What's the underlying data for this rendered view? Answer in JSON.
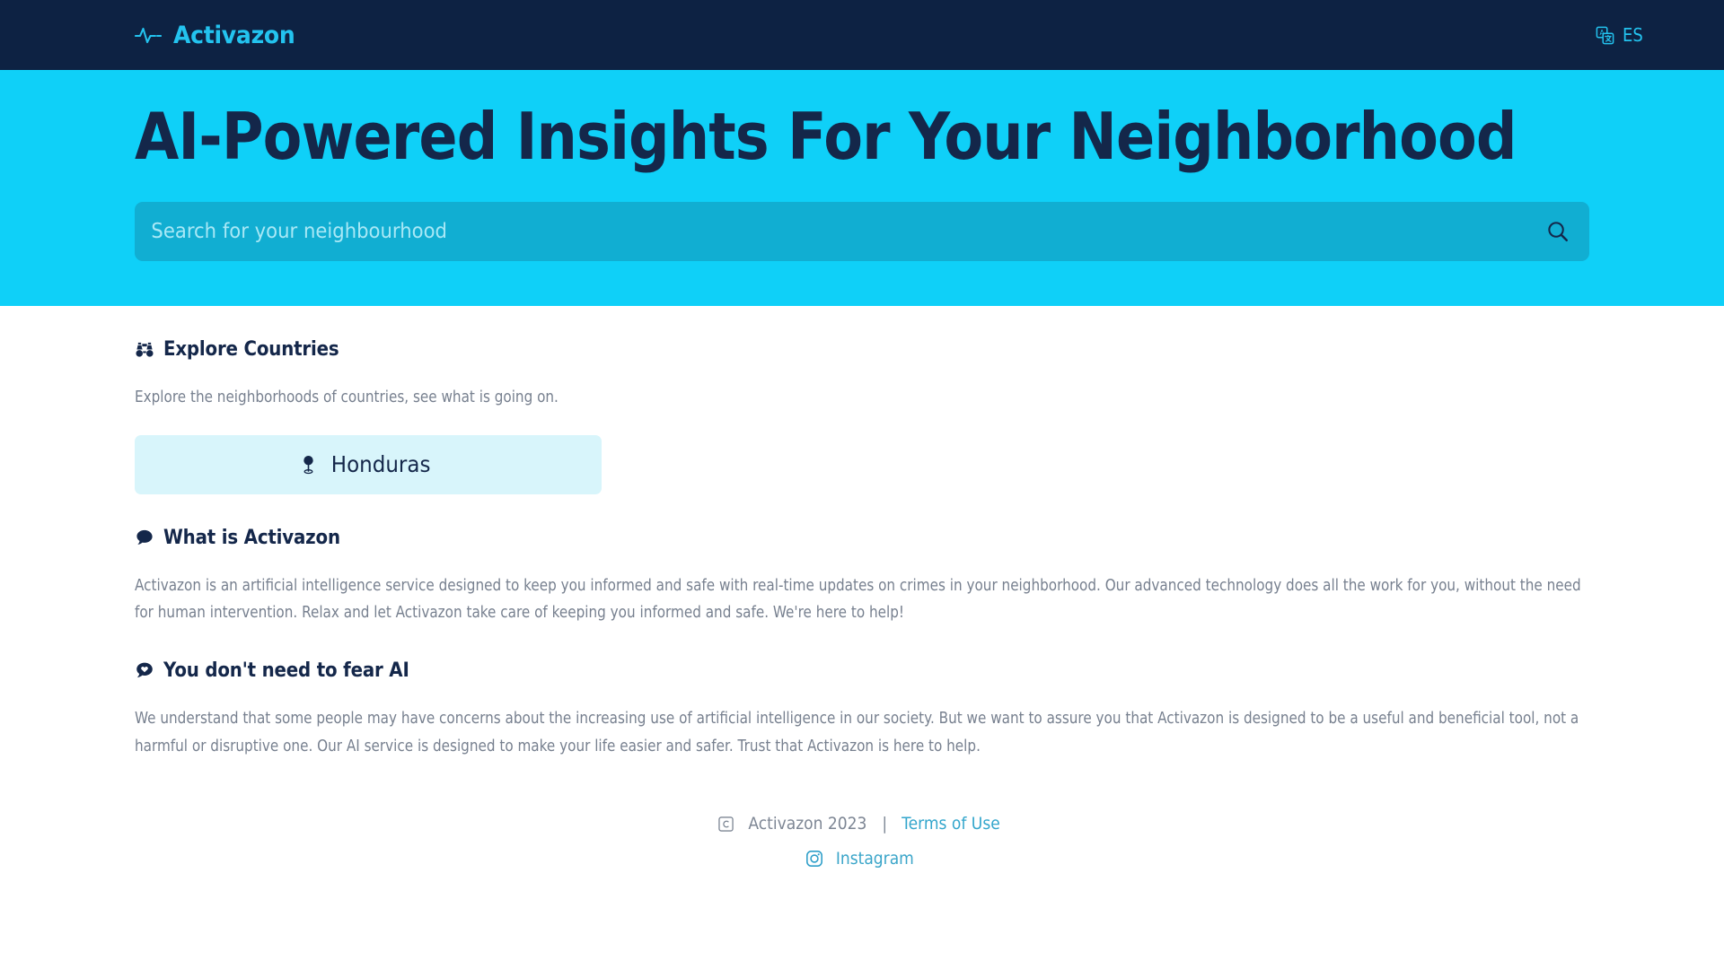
{
  "header": {
    "brand_name": "Activazon",
    "brand_icon": "pulse-wave-icon",
    "language": {
      "icon": "translate-icon",
      "label": "ES"
    }
  },
  "hero": {
    "title": "AI-Powered Insights For Your Neighborhood",
    "search": {
      "placeholder": "Search for your neighbourhood",
      "value": "",
      "button_icon": "search-icon"
    },
    "background_color": "#0fd0f8",
    "title_color": "#14274a"
  },
  "sections": {
    "explore": {
      "icon": "binoculars-icon",
      "title": "Explore Countries",
      "description": "Explore the neighborhoods of countries, see what is going on.",
      "countries": [
        {
          "name": "Honduras",
          "icon": "map-pin-icon"
        }
      ]
    },
    "what_is": {
      "icon": "chat-bubble-icon",
      "title": "What is Activazon",
      "body": "Activazon is an artificial intelligence service designed to keep you informed and safe with real-time updates on crimes in your neighborhood. Our advanced technology does all the work for you, without the need for human intervention. Relax and let Activazon take care of keeping you informed and safe. We're here to help!"
    },
    "fear_ai": {
      "icon": "chat-heart-icon",
      "title": "You don't need to fear AI",
      "body": "We understand that some people may have concerns about the increasing use of artificial intelligence in our society. But we want to assure you that Activazon is designed to be a useful and beneficial tool, not a harmful or disruptive one. Our AI service is designed to make your life easier and safer. Trust that Activazon is here to help."
    }
  },
  "footer": {
    "copyright_icon": "copyright-icon",
    "copyright_text": "Activazon 2023",
    "separator": "|",
    "terms_label": "Terms of Use",
    "social": {
      "icon": "instagram-icon",
      "label": "Instagram"
    },
    "link_color": "#33a6cc"
  }
}
